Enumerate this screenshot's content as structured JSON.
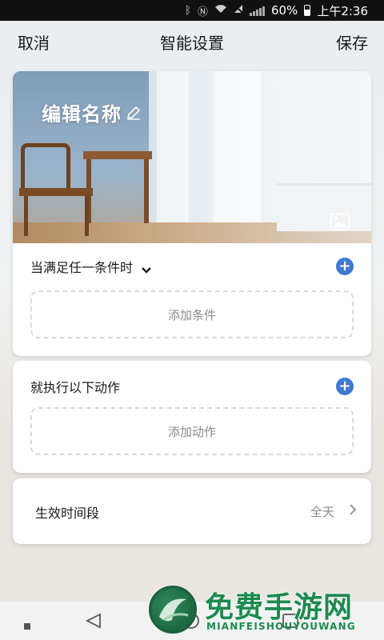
{
  "status_bar": {
    "battery": "60%",
    "time": "上午2:36",
    "icons": [
      "bluetooth-icon",
      "nfc-icon",
      "wifi-icon",
      "no-sim-icon",
      "signal-icon",
      "battery-icon"
    ]
  },
  "nav": {
    "cancel_label": "取消",
    "title": "智能设置",
    "save_label": "保存"
  },
  "banner": {
    "name": "编辑名称",
    "icons": [
      "pencil-icon",
      "image-icon"
    ]
  },
  "conditions": {
    "title": "当满足任一条件时",
    "add_label": "添加条件",
    "icons": [
      "chevron-down-icon",
      "add-circle-icon"
    ]
  },
  "actions": {
    "title": "就执行以下动作",
    "add_label": "添加动作",
    "icons": [
      "add-circle-icon"
    ]
  },
  "time_period": {
    "label": "生效时间段",
    "value": "全天",
    "icons": [
      "chevron-right-icon"
    ]
  },
  "watermark": {
    "cn": "免费手游网",
    "en": "MIANFEISHOUYOUWANG"
  },
  "colors": {
    "accent": "#3f78d6",
    "watermark": "#1c8a4f"
  }
}
